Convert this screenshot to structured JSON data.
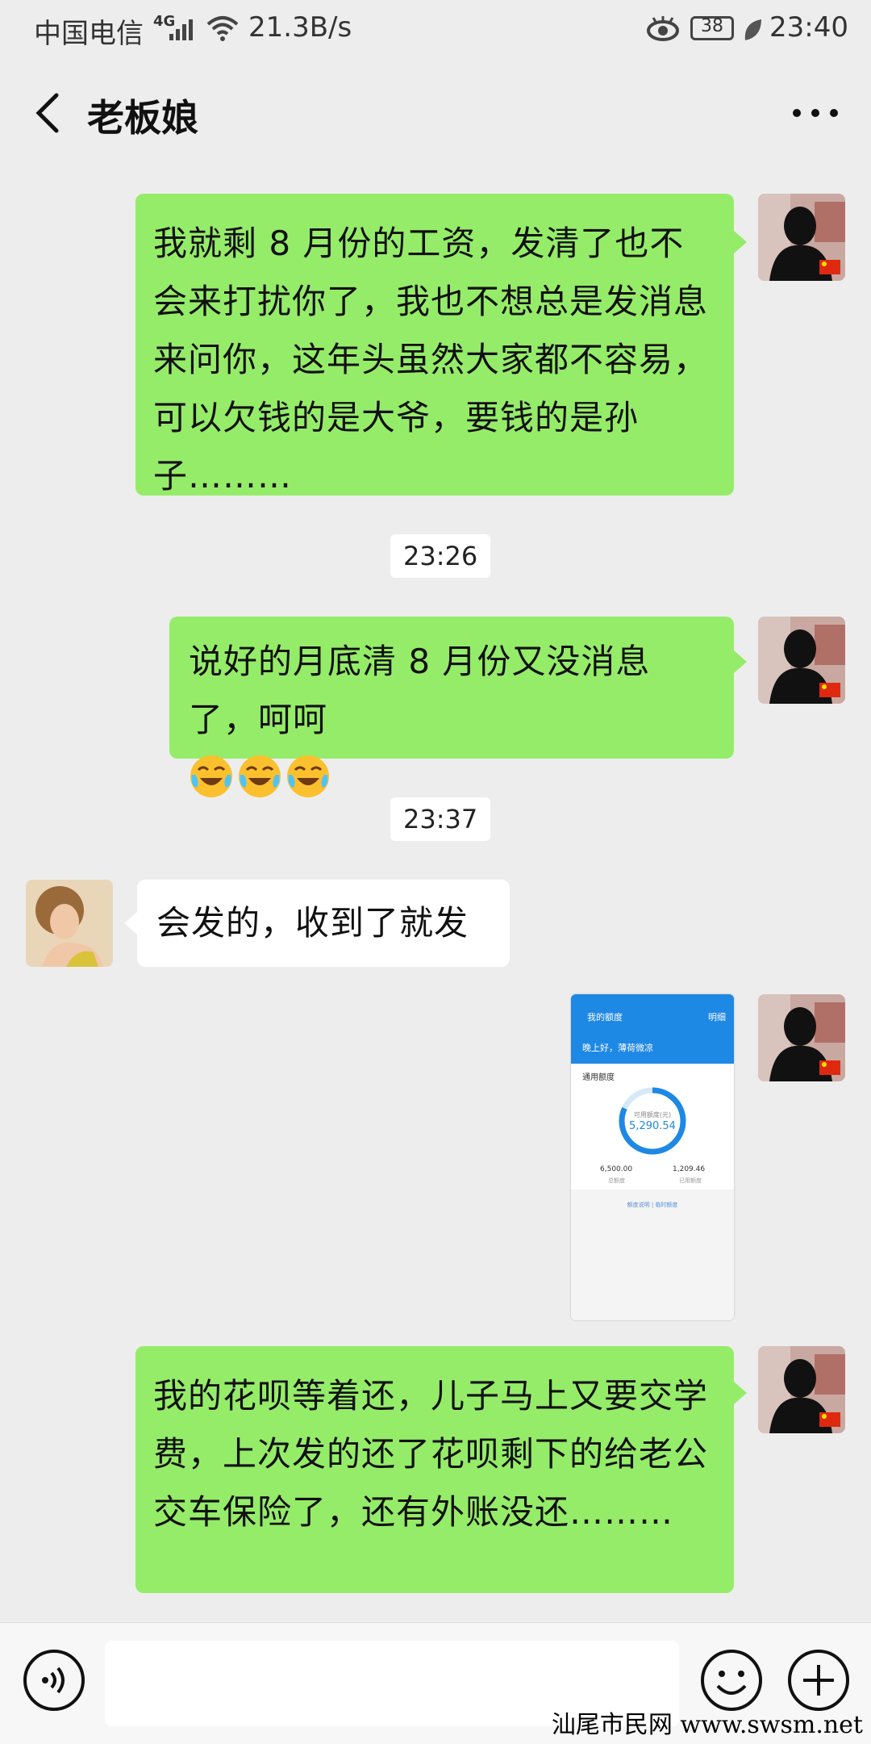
{
  "status_bar": {
    "carrier": "中国电信",
    "network": "4G",
    "speed": "21.3B/s",
    "battery": "38",
    "time": "23:40"
  },
  "header": {
    "title": "老板娘"
  },
  "messages": [
    {
      "type": "text",
      "side": "out",
      "text": "我就剩 8 月份的工资，发清了也不会来打扰你了，我也不想总是发消息来问你，这年头虽然大家都不容易，可以欠钱的是大爷，要钱的是孙子………"
    },
    {
      "type": "time",
      "text": "23:26"
    },
    {
      "type": "text",
      "side": "out",
      "text": "说好的月底清 8 月份又没消息了，呵呵"
    },
    {
      "type": "time",
      "text": "23:37"
    },
    {
      "type": "text",
      "side": "in",
      "text": "会发的，收到了就发"
    },
    {
      "type": "image",
      "side": "out",
      "screenshot": {
        "header_title": "我的额度",
        "header_right": "明细",
        "greeting": "晚上好，薄荷微凉",
        "section": "通用额度",
        "ring_label": "可用额度(元)",
        "ring_value": "5,290.54",
        "total_value": "6,500.00",
        "total_label": "总额度",
        "used_value": "1,209.46",
        "used_label": "已用额度",
        "links": "额度说明 | 临时额度"
      }
    },
    {
      "type": "text",
      "side": "out",
      "text": "我的花呗等着还，儿子马上又要交学费，上次发的还了花呗剩下的给老公交车保险了，还有外账没还………"
    }
  ],
  "emoji_name": "loudly-crying-laughing-emoji",
  "colors": {
    "outgoing_bubble": "#95ec69",
    "incoming_bubble": "#ffffff",
    "background": "#ededed",
    "alipay_blue": "#1e88e5"
  },
  "watermark": "汕尾市民网 www.swsm.net"
}
